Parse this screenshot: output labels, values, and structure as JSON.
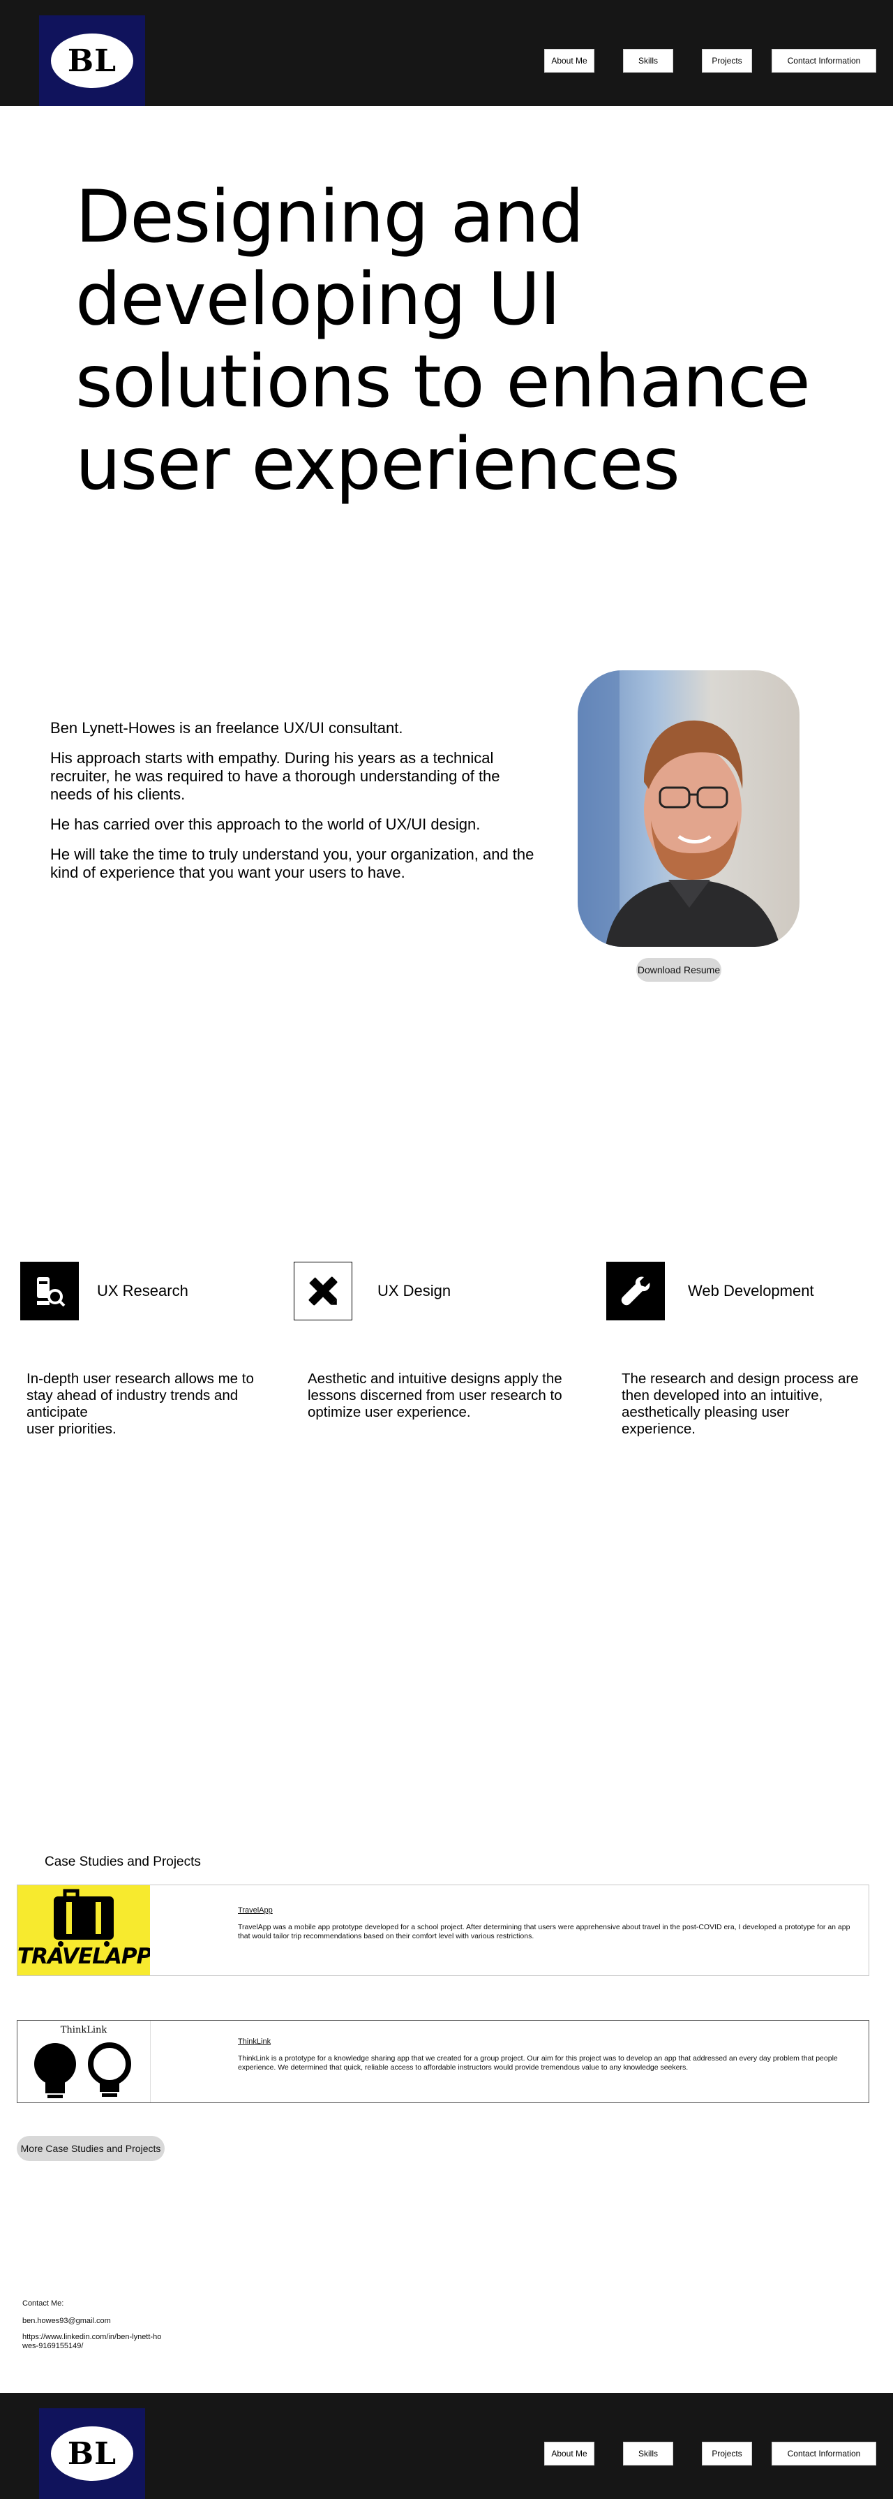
{
  "header": {
    "logo_text": "BL",
    "nav": [
      "About Me",
      "Skills",
      "Projects",
      "Contact Information"
    ]
  },
  "hero": {
    "headline": "Designing and developing UI solutions to enhance user experiences"
  },
  "about": {
    "paragraphs": [
      "Ben Lynett-Howes is an freelance UX/UI consultant.",
      "His approach starts with empathy. During his years as a technical recruiter, he was required to have a thorough understanding of the needs of his clients.",
      "He has carried over this approach to the world of UX/UI design.",
      "He will take the time to truly understand you, your organization, and the kind of experience that you want your users to have."
    ],
    "resume_button": "Download Resume"
  },
  "skills": [
    {
      "title": "UX Research",
      "icon": "research-icon",
      "description": "In-depth user research allows me to stay ahead of industry trends and anticipate\nuser priorities."
    },
    {
      "title": "UX Design",
      "icon": "design-tools-icon",
      "description": "Aesthetic and intuitive designs apply the lessons discerned from user research to optimize user experience."
    },
    {
      "title": "Web Development",
      "icon": "wrench-icon",
      "description": "The research and design process are then developed into an intuitive, aesthetically pleasing user experience."
    }
  ],
  "case_studies": {
    "heading": "Case Studies and Projects",
    "items": [
      {
        "title": "TravelApp",
        "thumb_text": "TRAVELAPP",
        "description": "TravelApp was a mobile app prototype developed for a school project. After determining that users were apprehensive about travel in the post-COVID era, I developed a prototype for an app that would tailor trip recommendations based on their comfort level with various restrictions."
      },
      {
        "title": "ThinkLink",
        "thumb_text": "ThinkLink",
        "description": "ThinkLink is a prototype for a knowledge sharing app that we created for a group project. Our aim for this project was to develop an app that addressed an every day problem that people experience. We determined that quick, reliable access to affordable instructors would provide tremendous value to any knowledge seekers."
      }
    ],
    "more_button": "More Case Studies and Projects"
  },
  "contact": {
    "label": "Contact Me:",
    "email": "ben.howes93@gmail.com",
    "linkedin": "https://www.linkedin.com/in/ben-lynett-howes-9169155149/"
  },
  "colors": {
    "bar": "#161616",
    "logo_bg": "#10135c",
    "travel_yellow": "#f7ea2e",
    "pill": "#d8d8d8"
  }
}
